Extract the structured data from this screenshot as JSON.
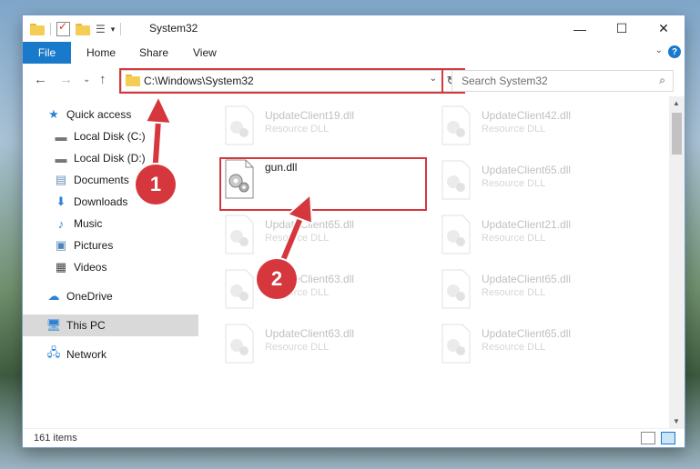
{
  "window": {
    "title": "System32"
  },
  "ribbon": {
    "tabs": [
      "File",
      "Home",
      "Share",
      "View"
    ],
    "help_label": "?"
  },
  "nav": {
    "address": "C:\\Windows\\System32",
    "search_placeholder": "Search System32"
  },
  "sidebar": {
    "items": [
      {
        "label": "Quick access",
        "icon": "star-icon"
      },
      {
        "label": "Local Disk (C:)",
        "icon": "drive-icon"
      },
      {
        "label": "Local Disk (D:)",
        "icon": "drive-icon"
      },
      {
        "label": "Documents",
        "icon": "documents-icon"
      },
      {
        "label": "Downloads",
        "icon": "download-icon"
      },
      {
        "label": "Music",
        "icon": "music-icon"
      },
      {
        "label": "Pictures",
        "icon": "pictures-icon"
      },
      {
        "label": "Videos",
        "icon": "videos-icon"
      },
      {
        "label": "OneDrive",
        "icon": "cloud-icon"
      },
      {
        "label": "This PC",
        "icon": "computer-icon"
      },
      {
        "label": "Network",
        "icon": "network-icon"
      }
    ]
  },
  "files": {
    "highlighted": {
      "name": "gun.dll"
    },
    "faded": [
      {
        "name": "UpdateClient19.dll",
        "type": "Resource DLL"
      },
      {
        "name": "UpdateClient42.dll",
        "type": "Resource DLL"
      },
      {
        "name": "UpdateClient65.dll",
        "type": "Resource DLL"
      },
      {
        "name": "UpdateClient65.dll",
        "type": "Resource DLL"
      },
      {
        "name": "UpdateClient21.dll",
        "type": "Resource DLL"
      },
      {
        "name": "UpdateClient63.dll",
        "type": "Resource DLL"
      },
      {
        "name": "UpdateClient65.dll",
        "type": "Resource DLL"
      },
      {
        "name": "UpdateClient63.dll",
        "type": "Resource DLL"
      },
      {
        "name": "UpdateClient65.dll",
        "type": "Resource DLL"
      }
    ]
  },
  "status": {
    "item_count": "161 items"
  },
  "callouts": {
    "one": "1",
    "two": "2"
  },
  "colors": {
    "accent": "#1979ca",
    "highlight": "#d5373d"
  }
}
